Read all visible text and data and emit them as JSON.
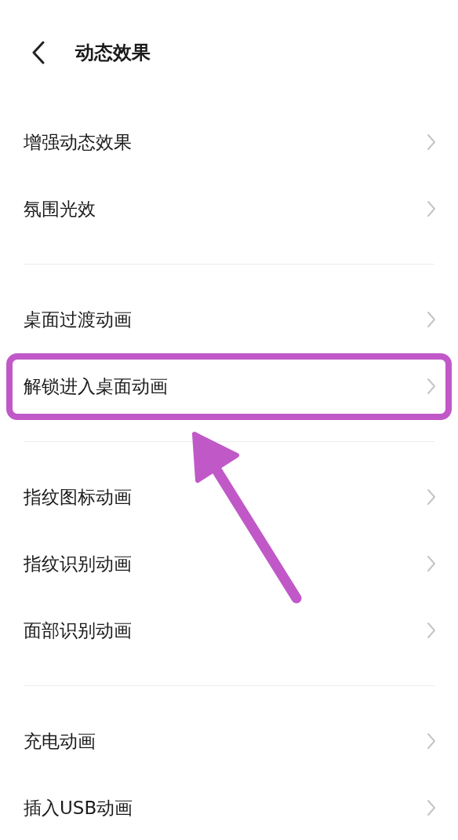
{
  "header": {
    "title": "动态效果"
  },
  "groups": [
    {
      "items": [
        {
          "label": "增强动态效果",
          "highlighted": false
        },
        {
          "label": "氛围光效",
          "highlighted": false
        }
      ]
    },
    {
      "items": [
        {
          "label": "桌面过渡动画",
          "highlighted": false
        },
        {
          "label": "解锁进入桌面动画",
          "highlighted": true
        }
      ]
    },
    {
      "items": [
        {
          "label": "指纹图标动画",
          "highlighted": false
        },
        {
          "label": "指纹识别动画",
          "highlighted": false
        },
        {
          "label": "面部识别动画",
          "highlighted": false
        }
      ]
    },
    {
      "items": [
        {
          "label": "充电动画",
          "highlighted": false
        },
        {
          "label": "插入USB动画",
          "highlighted": false
        }
      ]
    }
  ]
}
